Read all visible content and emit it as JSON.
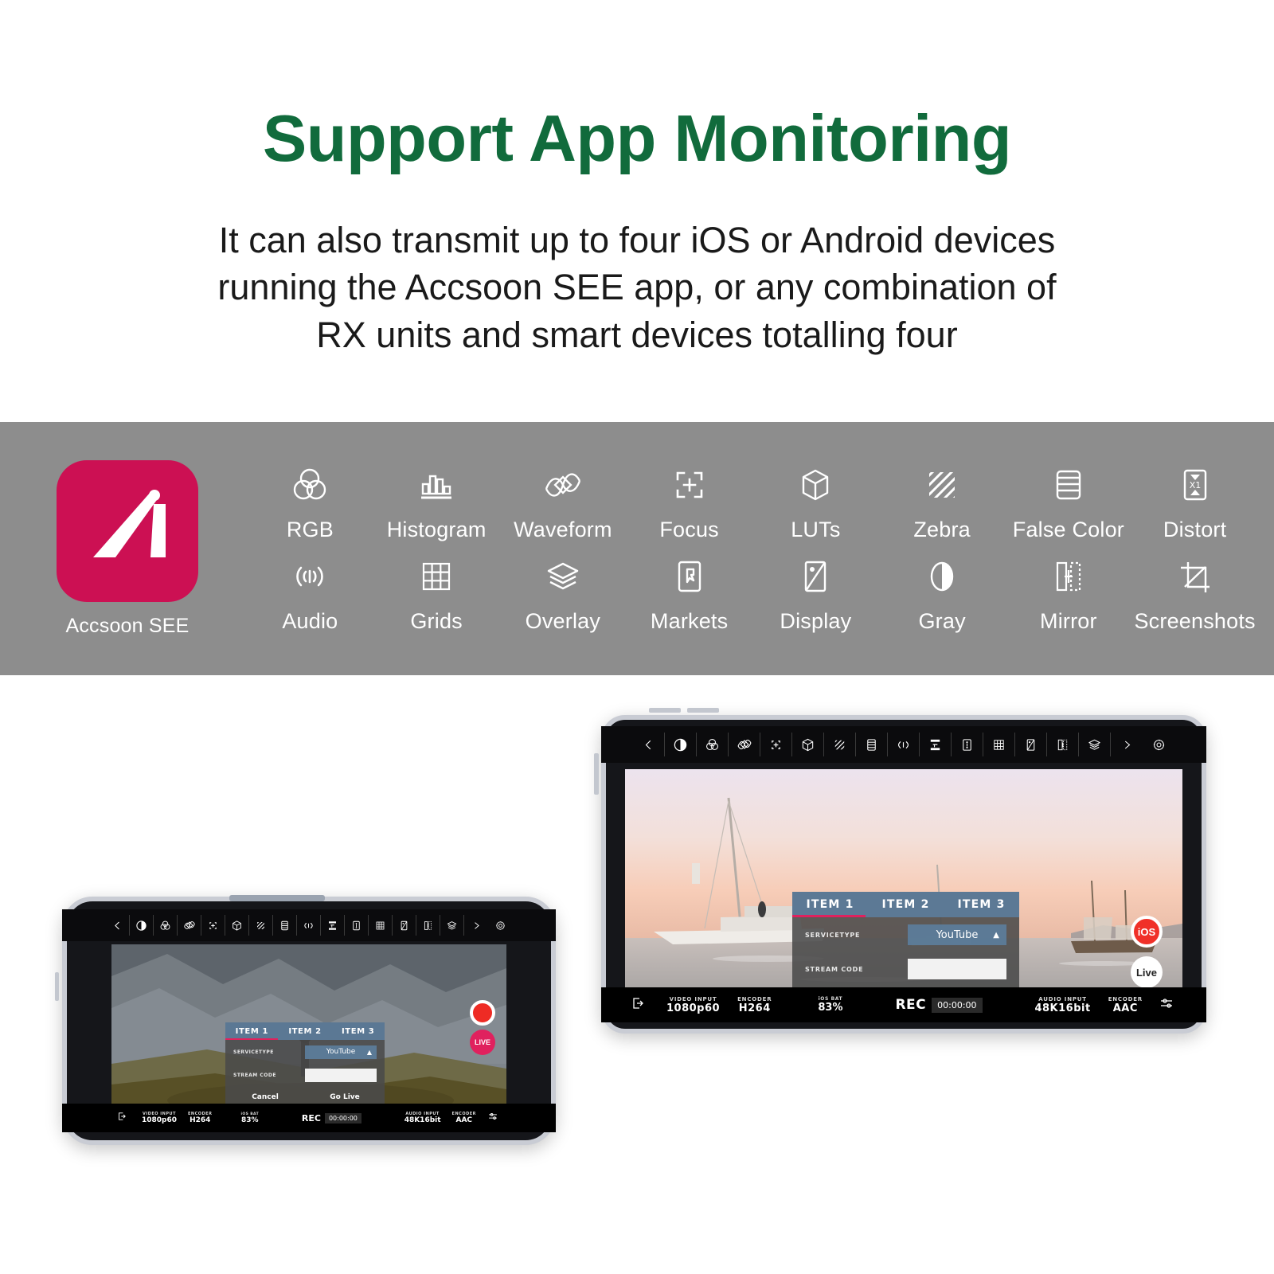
{
  "header": {
    "title": "Support App Monitoring",
    "subtitle_lines": [
      "It can also transmit up to four iOS or Android devices",
      "running the Accsoon SEE app, or any combination of",
      "RX units and smart devices totalling four"
    ]
  },
  "colors": {
    "title_green": "#116b3c",
    "band_gray": "#8d8d8d",
    "brand_crimson": "#cc1053",
    "accent_pink": "#e0215e",
    "rec_red": "#ee2b24",
    "dialog_blue": "#5c7c9a"
  },
  "band": {
    "app_name": "Accsoon SEE",
    "app_icon": "accsoon-logo-icon",
    "features": [
      {
        "label": "RGB",
        "icon": "rgb-circles-icon"
      },
      {
        "label": "Histogram",
        "icon": "histogram-icon"
      },
      {
        "label": "Waveform",
        "icon": "waveform-icon"
      },
      {
        "label": "Focus",
        "icon": "focus-brackets-icon"
      },
      {
        "label": "LUTs",
        "icon": "cube-icon"
      },
      {
        "label": "Zebra",
        "icon": "zebra-stripes-icon"
      },
      {
        "label": "False Color",
        "icon": "false-color-bars-icon"
      },
      {
        "label": "Distort",
        "icon": "distort-x1-icon"
      },
      {
        "label": "Audio",
        "icon": "audio-waves-icon"
      },
      {
        "label": "Grids",
        "icon": "grid-icon"
      },
      {
        "label": "Overlay",
        "icon": "layers-icon"
      },
      {
        "label": "Markets",
        "icon": "marker-pin-icon"
      },
      {
        "label": "Display",
        "icon": "display-icon"
      },
      {
        "label": "Gray",
        "icon": "gray-contrast-icon"
      },
      {
        "label": "Mirror",
        "icon": "mirror-icon"
      },
      {
        "label": "Screenshots",
        "icon": "screenshot-crop-icon"
      }
    ]
  },
  "app_ui": {
    "toolbar_icons": [
      "back-arrow-icon",
      "contrast-icon",
      "rgb-circles-icon",
      "waveform-icon",
      "focus-brackets-icon",
      "cube-icon",
      "zebra-stripes-icon",
      "false-color-bars-icon",
      "audio-waves-icon",
      "histogram-icon",
      "marker-pin-icon",
      "grid-icon",
      "display-icon",
      "mirror-icon",
      "layers-icon",
      "play-arrow-icon",
      "gear-icon"
    ],
    "dialog": {
      "tabs": [
        "ITEM 1",
        "ITEM 2",
        "ITEM 3"
      ],
      "active_tab_index": 0,
      "service_type_label": "SERVICETYPE",
      "service_type_value": "YouTube",
      "service_type_caret": "chevron-up-icon",
      "stream_code_label": "STREAM CODE",
      "stream_code_value": "",
      "cancel_label": "Cancel",
      "golive_label": "Go Live"
    },
    "statusbar": {
      "exit_icon": "exit-icon",
      "video_input_caption": "VIDEO INPUT",
      "video_input_value": "1080p60",
      "video_encoder_caption": "ENCODER",
      "video_encoder_value": "H264",
      "battery_caption": "iOS BAT",
      "battery_value": "83%",
      "rec_label": "REC",
      "rec_time": "00:00:00",
      "audio_input_caption": "AUDIO INPUT",
      "audio_input_value": "48K16bit",
      "audio_encoder_caption": "ENCODER",
      "audio_encoder_value": "AAC",
      "settings_icon": "sliders-icon"
    }
  },
  "phone": {
    "rec_button": "record-button",
    "live_badge": "LIVE"
  },
  "tablet": {
    "ios_badge": "iOS",
    "live_badge": "Live"
  }
}
